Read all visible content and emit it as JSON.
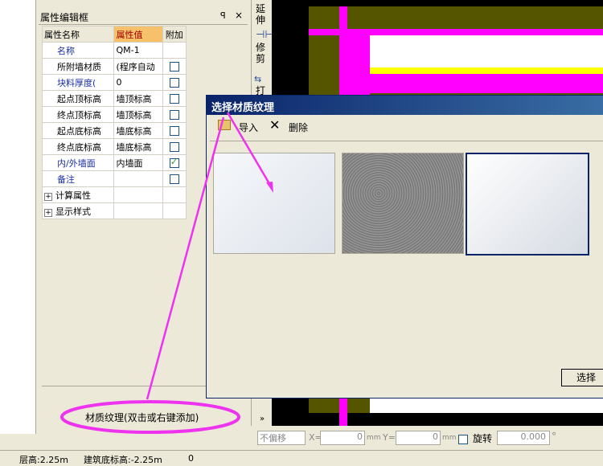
{
  "panel": {
    "title": "属性编辑框",
    "pin_glyph": "ꟼ",
    "close_glyph": "×",
    "headers": {
      "name": "属性名称",
      "value": "属性值",
      "extra": "附加"
    },
    "rows": [
      {
        "name": "名称",
        "value": "QM-1",
        "blue": true,
        "checkbox": false,
        "has_cb": false
      },
      {
        "name": "所附墙材质",
        "value": "(程序自动",
        "blue": false,
        "checkbox": false,
        "has_cb": true
      },
      {
        "name": "块料厚度(",
        "value": "0",
        "blue": true,
        "checkbox": false,
        "has_cb": true
      },
      {
        "name": "起点顶标高",
        "value": "墙顶标高",
        "blue": false,
        "checkbox": false,
        "has_cb": true
      },
      {
        "name": "终点顶标高",
        "value": "墙顶标高",
        "blue": false,
        "checkbox": false,
        "has_cb": true
      },
      {
        "name": "起点底标高",
        "value": "墙底标高",
        "blue": false,
        "checkbox": false,
        "has_cb": true
      },
      {
        "name": "终点底标高",
        "value": "墙底标高",
        "blue": false,
        "checkbox": false,
        "has_cb": true
      },
      {
        "name": "内/外墙面",
        "value": "内墙面",
        "blue": true,
        "checkbox": true,
        "has_cb": true
      },
      {
        "name": "备注",
        "value": "",
        "blue": true,
        "checkbox": false,
        "has_cb": true
      }
    ],
    "groups": [
      "计算属性",
      "显示样式"
    ],
    "texture_hint": "材质纹理(双击或右键添加)"
  },
  "toolstrip": {
    "extend": "延伸",
    "trim": "修剪",
    "partial": "打"
  },
  "dialog": {
    "title": "选择材质纹理",
    "import_label": "导入",
    "delete_label": "删除",
    "select_label": "选择",
    "thumbnails": [
      "light-gray-texture",
      "stucco-texture",
      "white-gradient-texture"
    ]
  },
  "bottom": {
    "offset_select": "不偏移",
    "x_label": "X=",
    "x_value": "0",
    "y_label": "Y=",
    "y_value": "0",
    "unit": "mm",
    "rotate_label": "旋转",
    "rotate_value": "0.000",
    "degree": "°"
  },
  "status": {
    "floor_height": "层高:2.25m",
    "base_elev": "建筑底标高:-2.25m",
    "extra": "0"
  },
  "colors": {
    "annotation": "#ee33ee",
    "title_bar": "#0a246a",
    "canvas_magenta": "#ff00ff",
    "canvas_olive": "#555500",
    "canvas_yellow": "#ffff00"
  }
}
